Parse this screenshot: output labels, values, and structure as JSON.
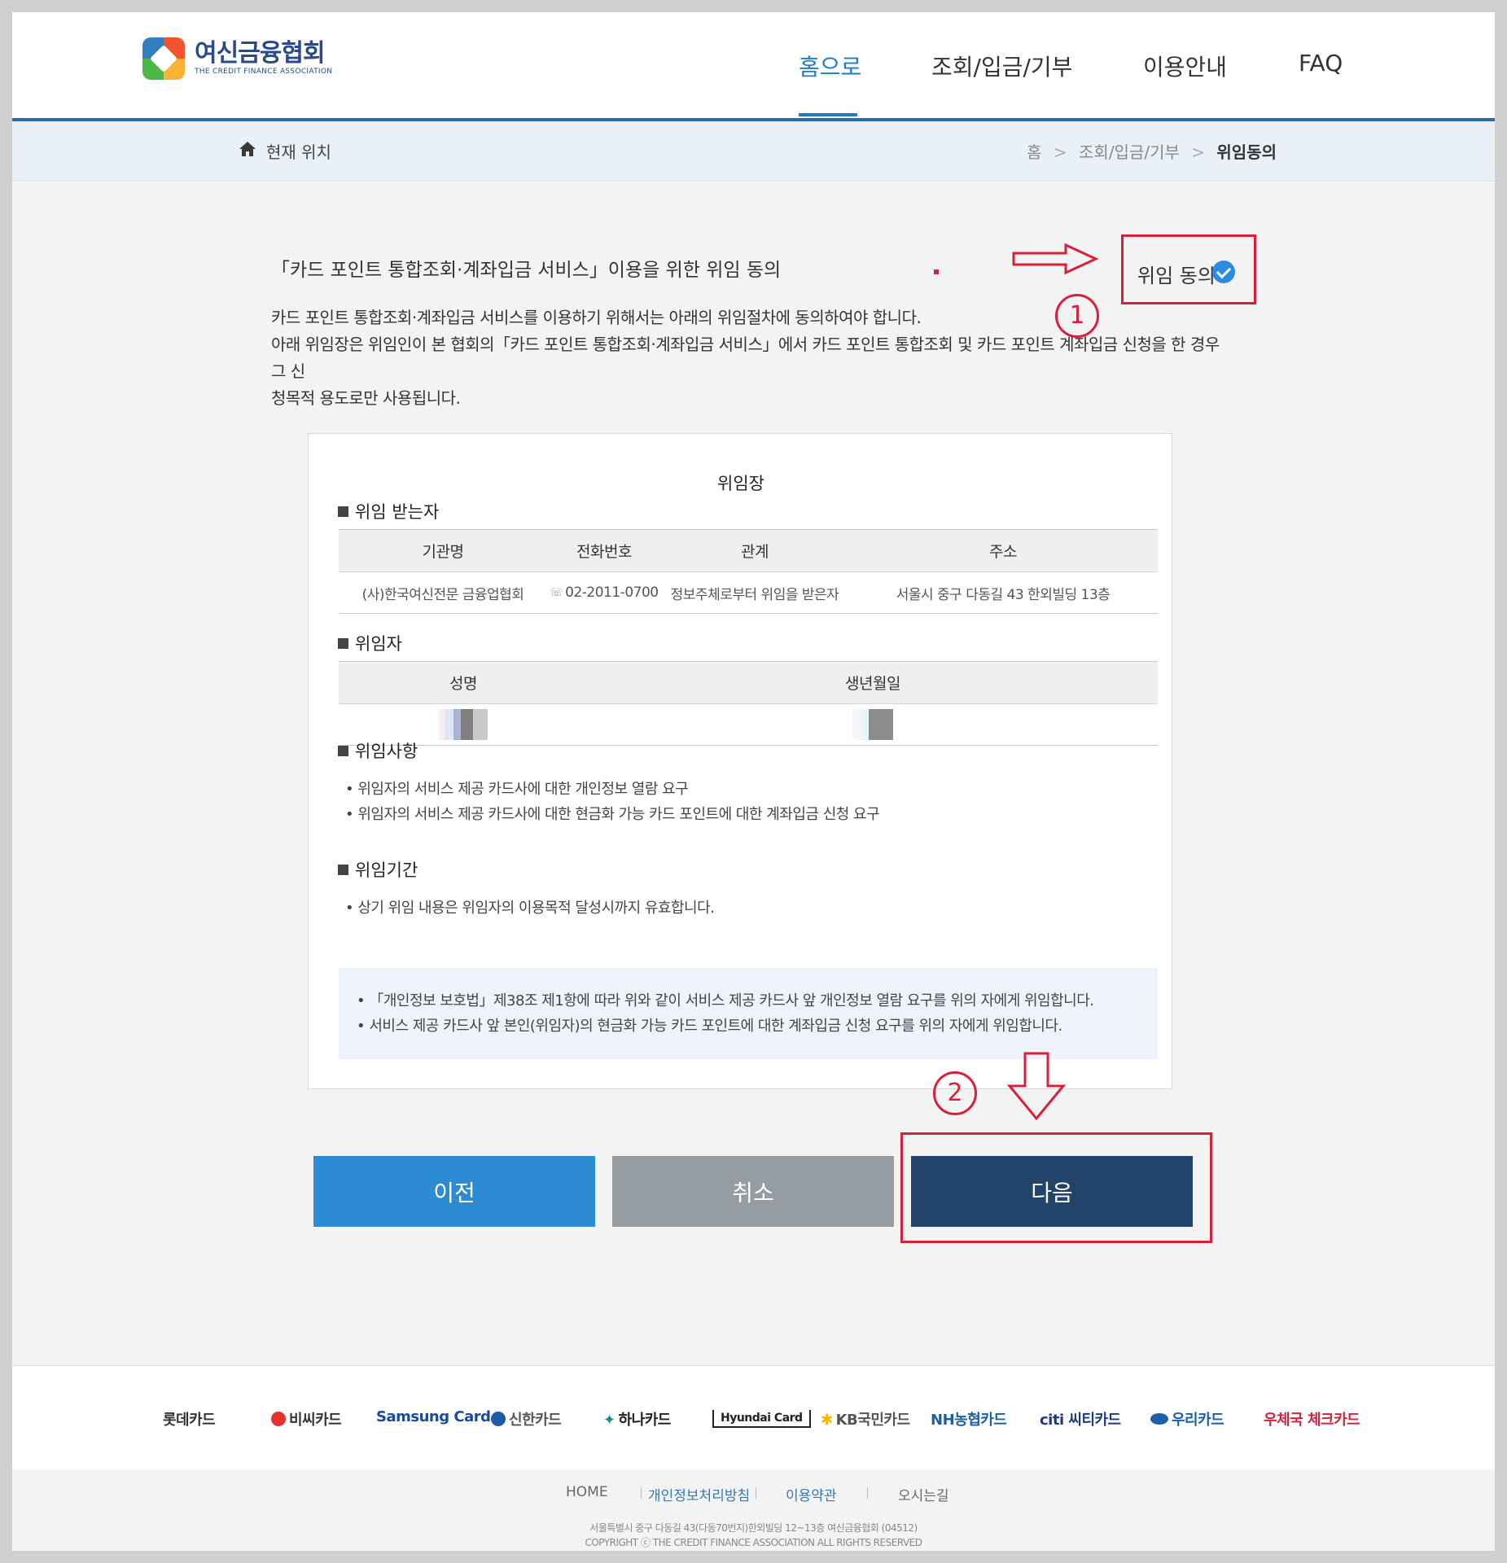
{
  "header": {
    "logo_ko": "여신금융협회",
    "logo_en": "THE CREDIT FINANCE ASSOCIATION",
    "nav": [
      "홈으로",
      "조회/입금/기부",
      "이용안내",
      "FAQ"
    ]
  },
  "breadcrumb": {
    "here_label": "현재 위치",
    "path": [
      "홈",
      "조회/입금/기부",
      "위임동의"
    ],
    "separator": ">"
  },
  "intro": {
    "title": "「카드 포인트 통합조회·계좌입금 서비스」이용을 위한 위임 동의",
    "desc_line1": "카드 포인트 통합조회·계좌입금 서비스를 이용하기 위해서는 아래의 위임절차에 동의하여야 합니다.",
    "desc_line2": "아래 위임장은 위임인이 본 협회의「카드 포인트 통합조회·계좌입금 서비스」에서 카드 포인트 통합조회 및 카드 포인트 계좌입금 신청을 한 경우 그 신",
    "desc_line3": "청목적 용도로만 사용됩니다."
  },
  "agree": {
    "label": "위임 동의",
    "checked": true
  },
  "annotations": {
    "step1": "1",
    "step2": "2",
    "color": "#d8203a"
  },
  "document": {
    "title": "위임장",
    "delegatee": {
      "heading": "위임 받는자",
      "columns": [
        "기관명",
        "전화번호",
        "관계",
        "주소"
      ],
      "row": [
        "(사)한국여신전문 금융업협회",
        "02-2011-0700",
        "정보주체로부터 위임을 받은자",
        "서울시 중구 다동길 43 한외빌딩 13층"
      ]
    },
    "delegator": {
      "heading": "위임자",
      "columns": [
        "성명",
        "생년월일"
      ]
    },
    "matters": {
      "heading": "위임사항",
      "items": [
        "• 위임자의 서비스 제공 카드사에 대한 개인정보 열람 요구",
        "• 위임자의 서비스 제공 카드사에 대한 현금화 가능 카드 포인트에 대한 계좌입금 신청 요구"
      ]
    },
    "period": {
      "heading": "위임기간",
      "items": [
        "• 상기 위임 내용은 위임자의 이용목적 달성시까지 유효합니다."
      ]
    },
    "notice": [
      "• 「개인정보 보호법」제38조 제1항에 따라 위와 같이 서비스 제공 카드사 앞 개인정보 열람 요구를 위의 자에게 위임합니다.",
      "• 서비스 제공 카드사 앞 본인(위임자)의 현금화 가능 카드 포인트에 대한 계좌입금 신청 요구를 위의 자에게 위임합니다."
    ]
  },
  "buttons": {
    "prev": "이전",
    "cancel": "취소",
    "next": "다음"
  },
  "partners": [
    {
      "name": "롯데카드",
      "color": "#333333"
    },
    {
      "name": "비씨카드",
      "color": "#333333"
    },
    {
      "name": "Samsung Card",
      "color": "#1a4a9c"
    },
    {
      "name": "신한카드",
      "color": "#555555"
    },
    {
      "name": "하나카드",
      "color": "#222222"
    },
    {
      "name": "Hyundai Card",
      "color": "#222222"
    },
    {
      "name": "KB국민카드",
      "color": "#555555"
    },
    {
      "name": "NH농협카드",
      "color": "#1a5fa8"
    },
    {
      "name": "citi 씨티카드",
      "color": "#1a3a8a"
    },
    {
      "name": "우리카드",
      "color": "#1a5fa8"
    },
    {
      "name": "우체국 체크카드",
      "color": "#d8203a"
    }
  ],
  "footer": {
    "links": [
      {
        "label": "HOME",
        "color": "#666666"
      },
      {
        "label": "개인정보처리방침",
        "color": "#2d7ac0"
      },
      {
        "label": "이용약관",
        "color": "#2d7ac0"
      },
      {
        "label": "오시는길",
        "color": "#666666"
      }
    ],
    "address": "서울특별시 중구 다동길 43(다동70번지)한외빌딩 12~13층 여신금융협회 (04512)",
    "copyright": "COPYRIGHT ⓒ THE CREDIT FINANCE ASSOCIATION ALL RIGHTS RESERVED"
  }
}
